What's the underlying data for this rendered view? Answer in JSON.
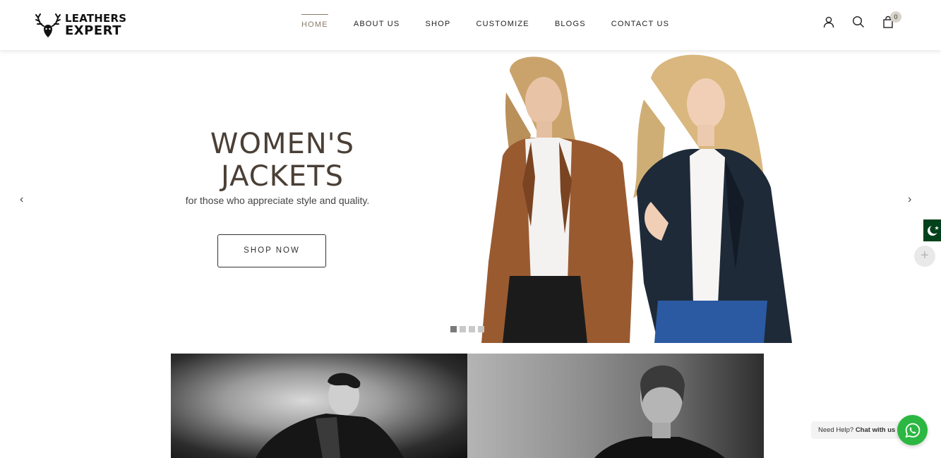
{
  "brand": {
    "line1": "LEATHERS",
    "line2": "EXPERT"
  },
  "nav": {
    "items": [
      {
        "label": "HOME",
        "active": true
      },
      {
        "label": "ABOUT US"
      },
      {
        "label": "SHOP"
      },
      {
        "label": "CUSTOMIZE"
      },
      {
        "label": "BLOGS"
      },
      {
        "label": "CONTACT US"
      }
    ]
  },
  "header_icons": {
    "account": "user-icon",
    "search": "search-icon",
    "cart": "bag-icon",
    "cart_count": "0"
  },
  "hero": {
    "title_line1": "WOMEN'S",
    "title_line2": "JACKETS",
    "subtitle": "for those who appreciate style and quality.",
    "cta": "SHOP NOW",
    "prev_arrow": "‹",
    "next_arrow": "›",
    "slide_count": 4,
    "active_slide": 1
  },
  "side": {
    "flag": "pakistan-flag-icon",
    "plus": "+"
  },
  "chat": {
    "prefix": "Need Help?",
    "action": "Chat with us"
  },
  "colors": {
    "accent": "#8a7b6a",
    "title": "#4a3f36",
    "whatsapp": "#2bb741",
    "flag_green": "#01411c"
  }
}
